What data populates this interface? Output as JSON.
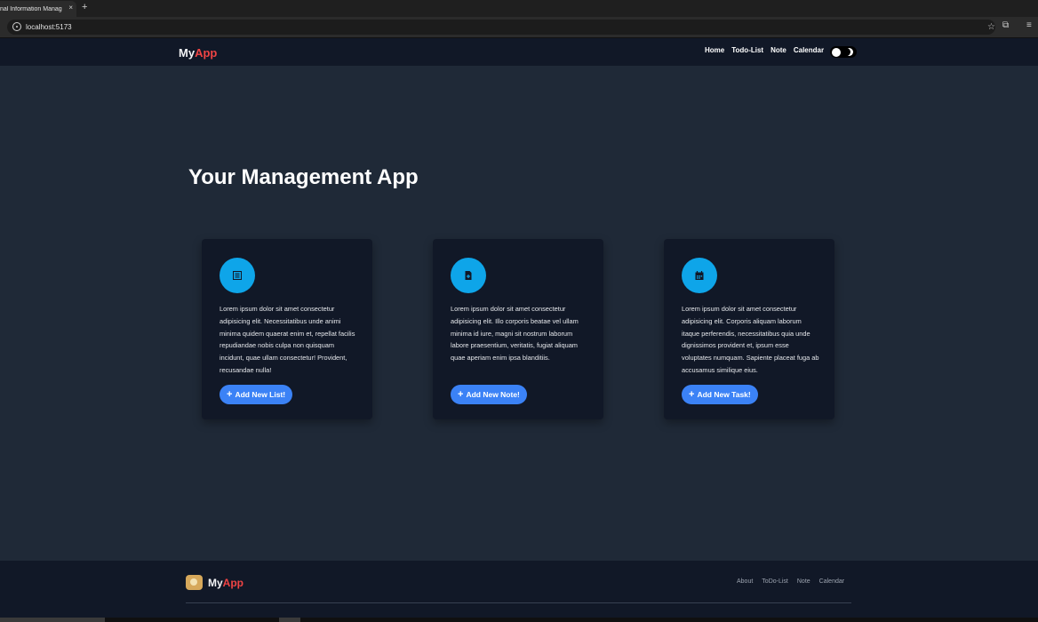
{
  "browser": {
    "tab_title": "nal Information Managem",
    "tab_close": "×",
    "new_tab": "+",
    "url": "localhost:5173",
    "star": "☆",
    "extensions": "⧉",
    "menu": "≡"
  },
  "header": {
    "brand_part1": "My",
    "brand_part2": "App",
    "nav": [
      "Home",
      "Todo-List",
      "Note",
      "Calendar"
    ]
  },
  "main": {
    "title": "Your Management App",
    "cards": [
      {
        "icon": "list-icon",
        "text": "Lorem ipsum dolor sit amet consectetur adipisicing elit. Necessitatibus unde animi minima quidem quaerat enim et, repellat facilis repudiandae nobis culpa non quisquam incidunt, quae ullam consectetur! Provident, recusandae nulla!",
        "button": "Add New List!"
      },
      {
        "icon": "note-icon",
        "text": "Lorem ipsum dolor sit amet consectetur adipisicing elit. Illo corporis beatae vel ullam minima id iure, magni sit nostrum laborum labore praesentium, veritatis, fugiat aliquam quae aperiam enim ipsa blanditiis.",
        "button": "Add New Note!"
      },
      {
        "icon": "calendar-icon",
        "text": "Lorem ipsum dolor sit amet consectetur adipisicing elit. Corporis aliquam laborum itaque perferendis, necessitatibus quia unde dignissimos provident et, ipsum esse voluptates numquam. Sapiente placeat fuga ab accusamus similique eius.",
        "button": "Add New Task!"
      }
    ],
    "button_plus": "+"
  },
  "footer": {
    "brand_part1": "My",
    "brand_part2": "App",
    "links": [
      "About",
      "ToDo-List",
      "Note",
      "Calendar"
    ]
  },
  "colors": {
    "accent": "#3b82f6",
    "icon_circle": "#0ea5e9",
    "brand_red": "#ef4444",
    "background": "#1f2937",
    "header": "#111827"
  }
}
